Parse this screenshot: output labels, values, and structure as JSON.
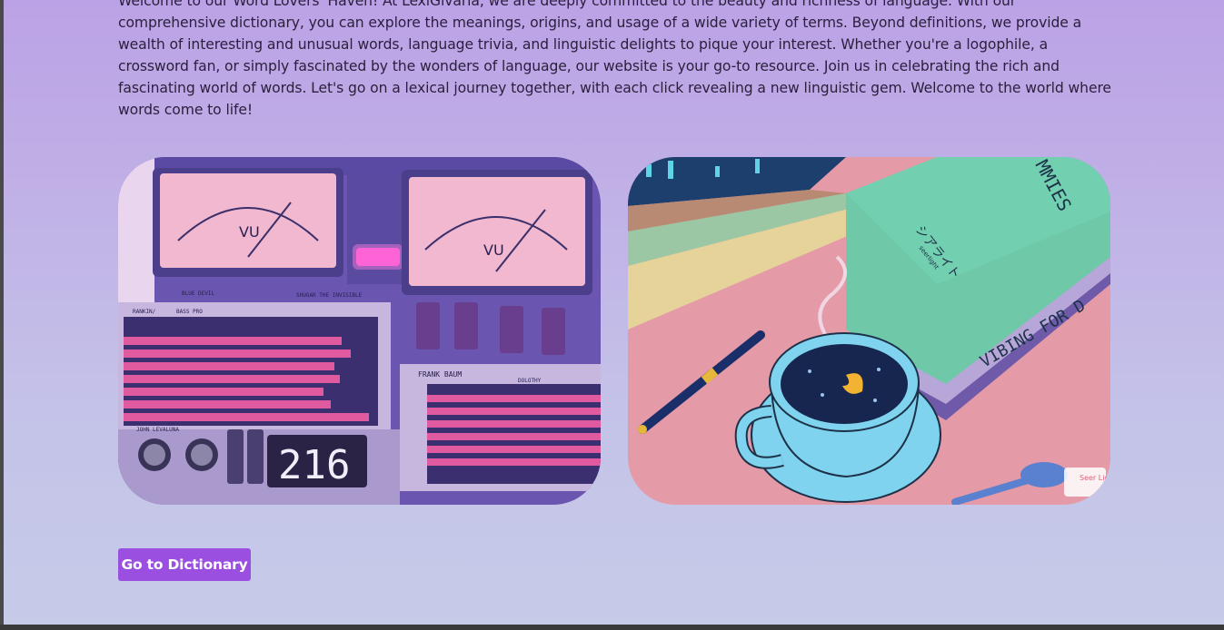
{
  "intro": {
    "text": "Welcome to our Word Lovers' Haven! At LexiGivaria, we are deeply committed to the beauty and richness of language. With our comprehensive dictionary, you can explore the meanings, origins, and usage of a wide variety of terms. Beyond definitions, we provide a wealth of interesting and unusual words, language trivia, and linguistic delights to pique your interest. Whether you're a logophile, a crossword fan, or simply fascinated by the wonders of language, our website is your go-to resource. Join us in celebrating the rich and fascinating world of words. Let's go on a lexical journey together, with each click revealing a new linguistic gem. Welcome to the world where words come to life!"
  },
  "images": {
    "left": {
      "labels": {
        "vu_left": "VU",
        "vu_right": "VU",
        "counter": "216",
        "panel_a": "RANKIN/",
        "panel_a2": "BASS PRO",
        "panel_b": "FRANK BAUM",
        "panel_b2": "DOLOTHY",
        "panel_c": "BLUE DEVIL",
        "panel_d": "JOHN LEVALUNA",
        "panel_e": "SHUGAR THE INVISIBLE"
      }
    },
    "right": {
      "labels": {
        "book_spine": "VIBING FOR D",
        "book_top": "MMIES",
        "book_jp": "シアライト",
        "book_sub": "seerlight",
        "watermark": "Seer Ligh"
      }
    }
  },
  "actions": {
    "dictionary_button": "Go to Dictionary"
  },
  "colors": {
    "accent": "#9a4fe0",
    "background_top": "#bba2e6",
    "background_bottom": "#c6cbe8"
  }
}
